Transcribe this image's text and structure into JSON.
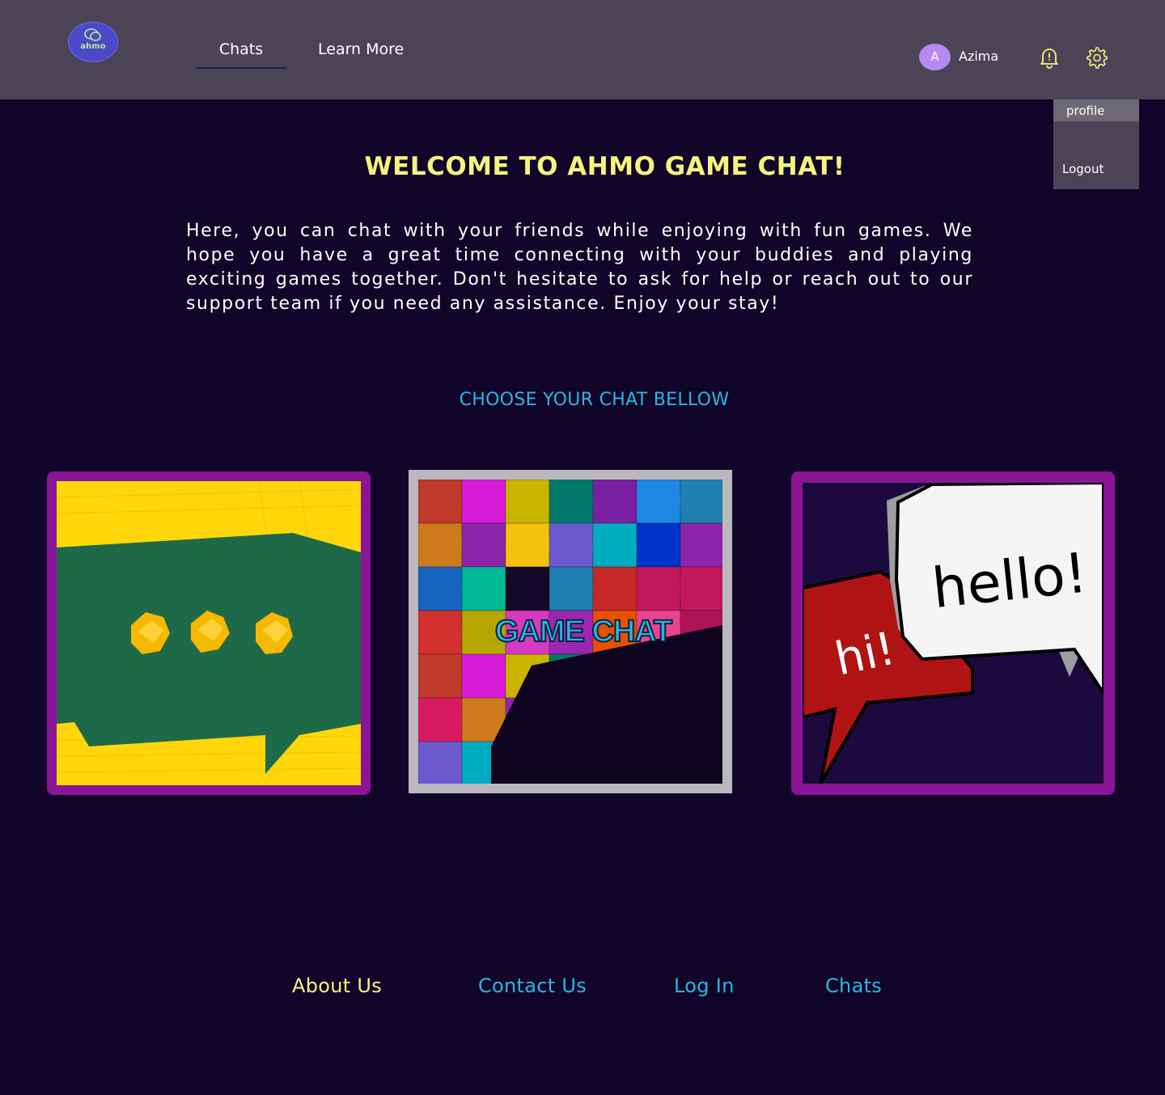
{
  "header": {
    "logo_text": "ahmo",
    "nav": [
      {
        "label": "Chats",
        "active": true
      },
      {
        "label": "Learn More",
        "active": false
      }
    ],
    "user": {
      "initial": "A",
      "name": "Azima"
    },
    "icons": [
      "bell-icon",
      "gear-icon"
    ]
  },
  "dropdown": {
    "profile": "profile",
    "logout": "Logout"
  },
  "main": {
    "title": "WELCOME TO AHMO GAME CHAT!",
    "intro": "Here, you can chat with your friends while enjoying with fun games. We hope you have a great time connecting with your buddies and playing exciting games together. Don't hesitate to ask for help or reach out to our support team if you need any assistance. Enjoy your stay!",
    "choose": "CHOOSE YOUR CHAT BELLOW"
  },
  "cards": [
    {
      "name": "speech-bubble-chat-card"
    },
    {
      "name": "game-chat-card",
      "label": "GAME CHAT"
    },
    {
      "name": "hello-chat-card",
      "text_hi": "hi!",
      "text_hello": "hello!"
    }
  ],
  "footer": {
    "links": [
      "About Us",
      "Contact Us",
      "Log In",
      "Chats"
    ]
  },
  "colors": {
    "background": "#12052a",
    "header": "#4a4456",
    "yellow": "#f6f37e",
    "cyan": "#29b7e0",
    "card_border": "#8a1596"
  }
}
